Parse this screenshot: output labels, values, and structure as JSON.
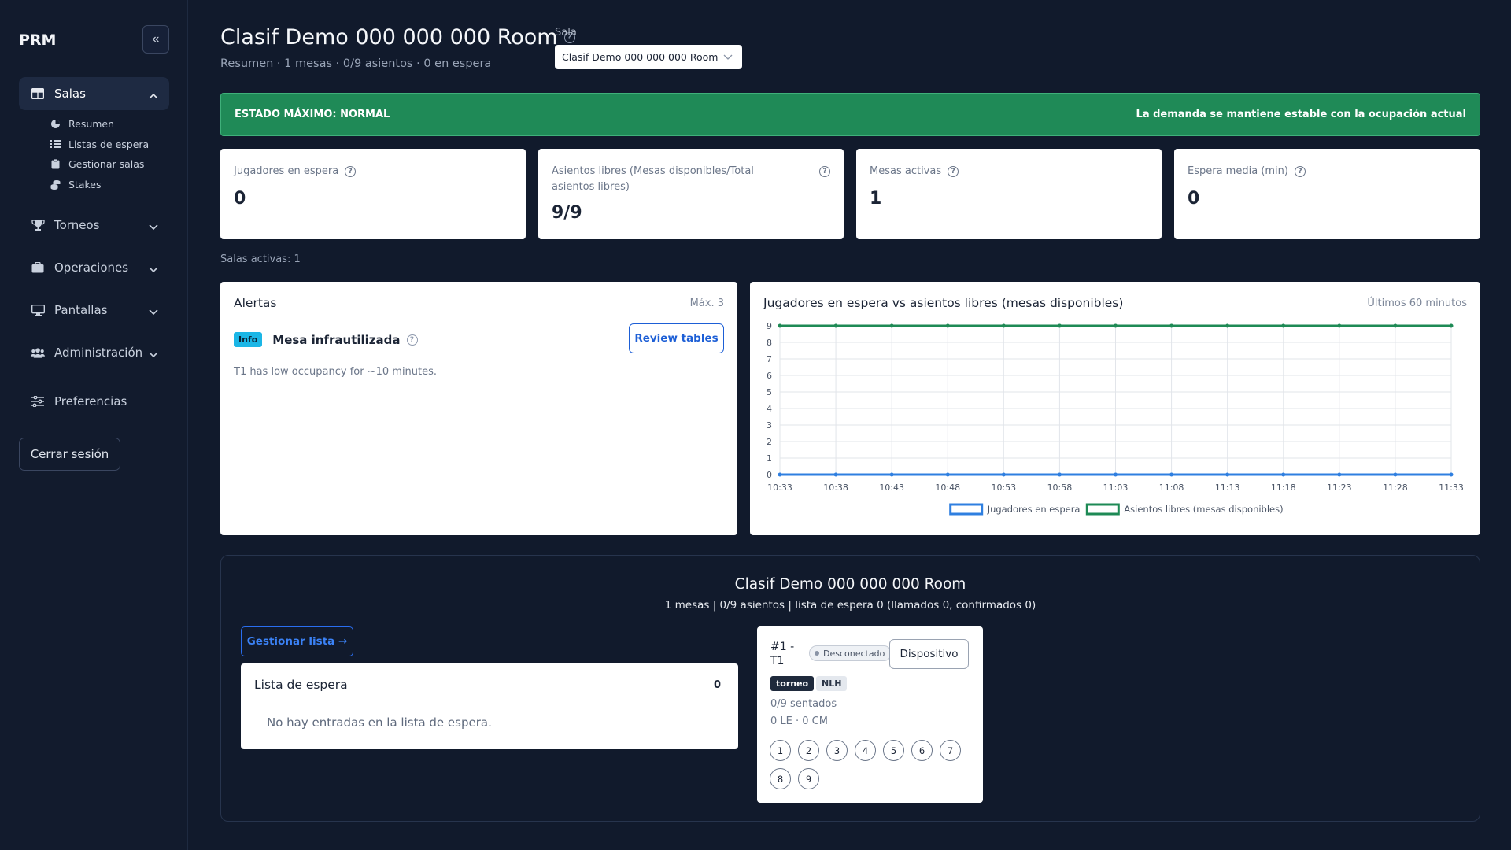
{
  "sidebar": {
    "brand": "PRM",
    "collapse_glyph": "«",
    "items": [
      {
        "label": "Salas",
        "icon": "table-icon"
      },
      {
        "label": "Torneos",
        "icon": "trophy-icon"
      },
      {
        "label": "Operaciones",
        "icon": "briefcase-icon"
      },
      {
        "label": "Pantallas",
        "icon": "monitor-icon"
      },
      {
        "label": "Administración",
        "icon": "users-icon"
      },
      {
        "label": "Preferencias",
        "icon": "sliders-icon"
      }
    ],
    "sub_items": [
      {
        "label": "Resumen",
        "icon": "pie-icon"
      },
      {
        "label": "Listas de espera",
        "icon": "list-icon"
      },
      {
        "label": "Gestionar salas",
        "icon": "clipboard-icon"
      },
      {
        "label": "Stakes",
        "icon": "coins-icon"
      }
    ],
    "logout": "Cerrar sesión"
  },
  "header": {
    "title": "Clasif Demo 000 000 000 Room",
    "subtitle": "Resumen · 1 mesas · 0/9 asientos · 0 en espera",
    "sala_label": "Sala",
    "sala_value": "Clasif Demo 000 000 000 Room"
  },
  "banner": {
    "left": "ESTADO MÁXIMO: NORMAL",
    "right": "La demanda se mantiene estable con la ocupación actual",
    "color": "#1f8a57"
  },
  "kpis": [
    {
      "label": "Jugadores en espera",
      "value": "0"
    },
    {
      "label": "Asientos libres (Mesas disponibles/Total asientos libres)",
      "value": "9/9"
    },
    {
      "label": "Mesas activas",
      "value": "1"
    },
    {
      "label": "Espera media (min)",
      "value": "0"
    }
  ],
  "active_rooms": "Salas activas: 1",
  "alerts": {
    "title": "Alertas",
    "max": "Máx. 3",
    "items": [
      {
        "badge": "Info",
        "title": "Mesa infrautilizada",
        "text": "T1 has low occupancy for ~10 minutes.",
        "action": "Review tables"
      }
    ]
  },
  "chart": {
    "title": "Jugadores en espera vs asientos libres (mesas disponibles)",
    "range_label": "Últimos 60 minutos"
  },
  "chart_data": {
    "type": "line",
    "x": [
      "10:33",
      "10:38",
      "10:43",
      "10:48",
      "10:53",
      "10:58",
      "11:03",
      "11:08",
      "11:13",
      "11:18",
      "11:23",
      "11:28",
      "11:33"
    ],
    "ylim": [
      0,
      9
    ],
    "yticks": [
      "0",
      "1",
      "2",
      "3",
      "4",
      "5",
      "6",
      "7",
      "8",
      "9"
    ],
    "grid": true,
    "legend_position": "bottom",
    "series": [
      {
        "name": "Jugadores en espera",
        "values": [
          0,
          0,
          0,
          0,
          0,
          0,
          0,
          0,
          0,
          0,
          0,
          0,
          0
        ],
        "color": "#2f7fe0"
      },
      {
        "name": "Asientos libres (mesas disponibles)",
        "values": [
          9,
          9,
          9,
          9,
          9,
          9,
          9,
          9,
          9,
          9,
          9,
          9,
          9
        ],
        "color": "#1e8a55"
      }
    ]
  },
  "room": {
    "title": "Clasif Demo 000 000 000 Room",
    "subtitle": "1 mesas | 0/9 asientos | lista de espera 0 (llamados 0, confirmados 0)",
    "manage": "Gestionar lista →",
    "waitlist": {
      "title": "Lista de espera",
      "count": "0",
      "empty": "No hay entradas en la lista de espera."
    },
    "table": {
      "name": "#1 - T1",
      "status": "Desconectado",
      "device": "Dispositivo",
      "tags": [
        "torneo",
        "NLH"
      ],
      "seated": "0/9 sentados",
      "le_cm": "0 LE · 0 CM",
      "seats": [
        "1",
        "2",
        "3",
        "4",
        "5",
        "6",
        "7",
        "8",
        "9"
      ]
    }
  }
}
